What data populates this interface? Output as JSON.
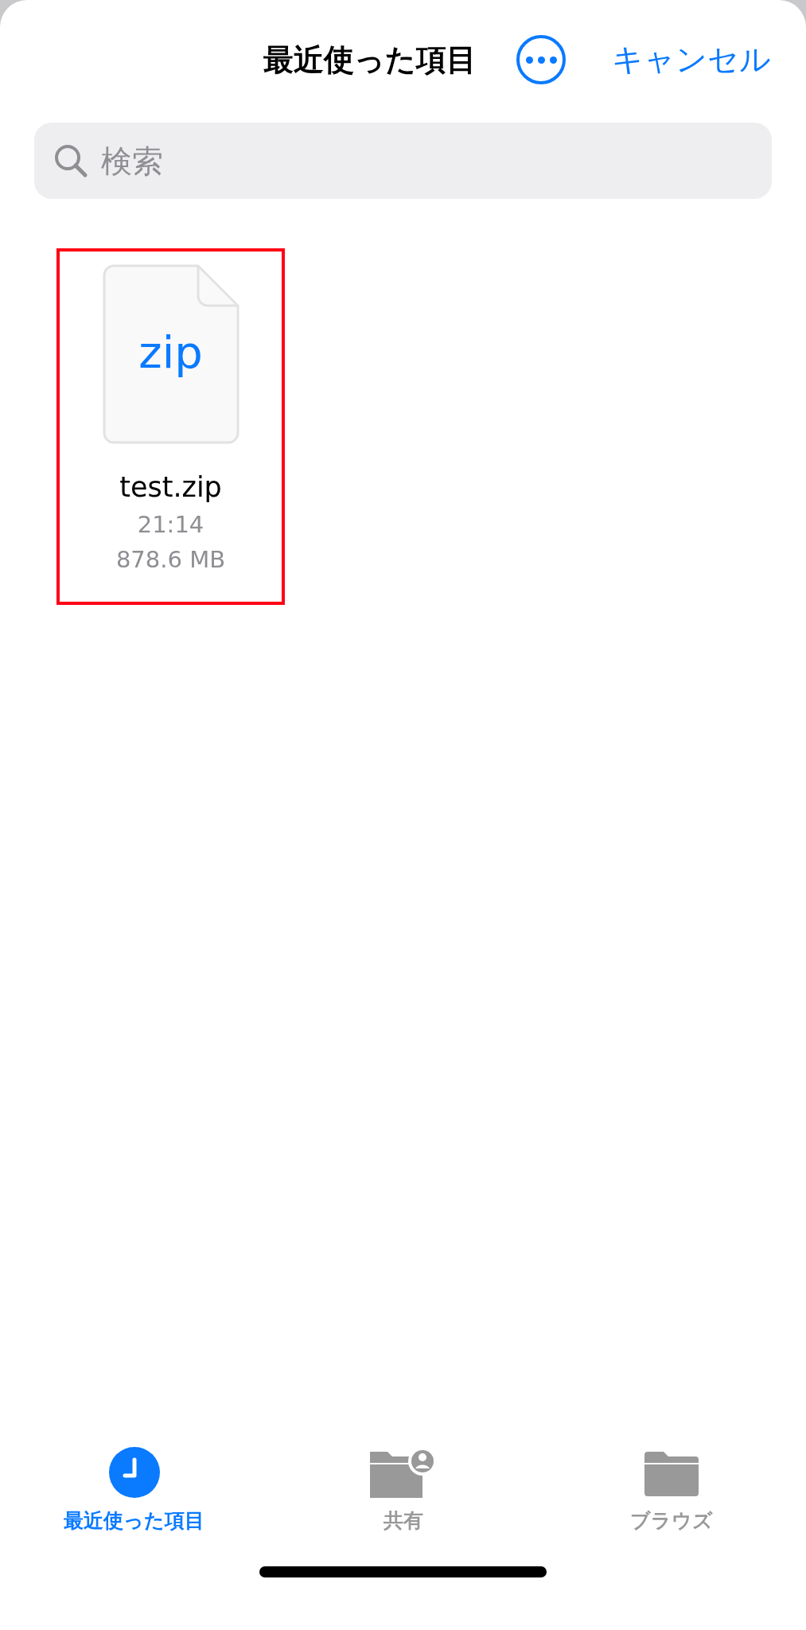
{
  "header": {
    "title": "最近使った項目",
    "cancel": "キャンセル"
  },
  "search": {
    "placeholder": "検索"
  },
  "files": [
    {
      "badge": "zip",
      "name": "test.zip",
      "time": "21:14",
      "size": "878.6 MB",
      "highlighted": true
    }
  ],
  "tabs": [
    {
      "kind": "clock",
      "label": "最近使った項目",
      "selected": true
    },
    {
      "kind": "shared-folder",
      "label": "共有",
      "selected": false
    },
    {
      "kind": "folder",
      "label": "ブラウズ",
      "selected": false
    }
  ]
}
